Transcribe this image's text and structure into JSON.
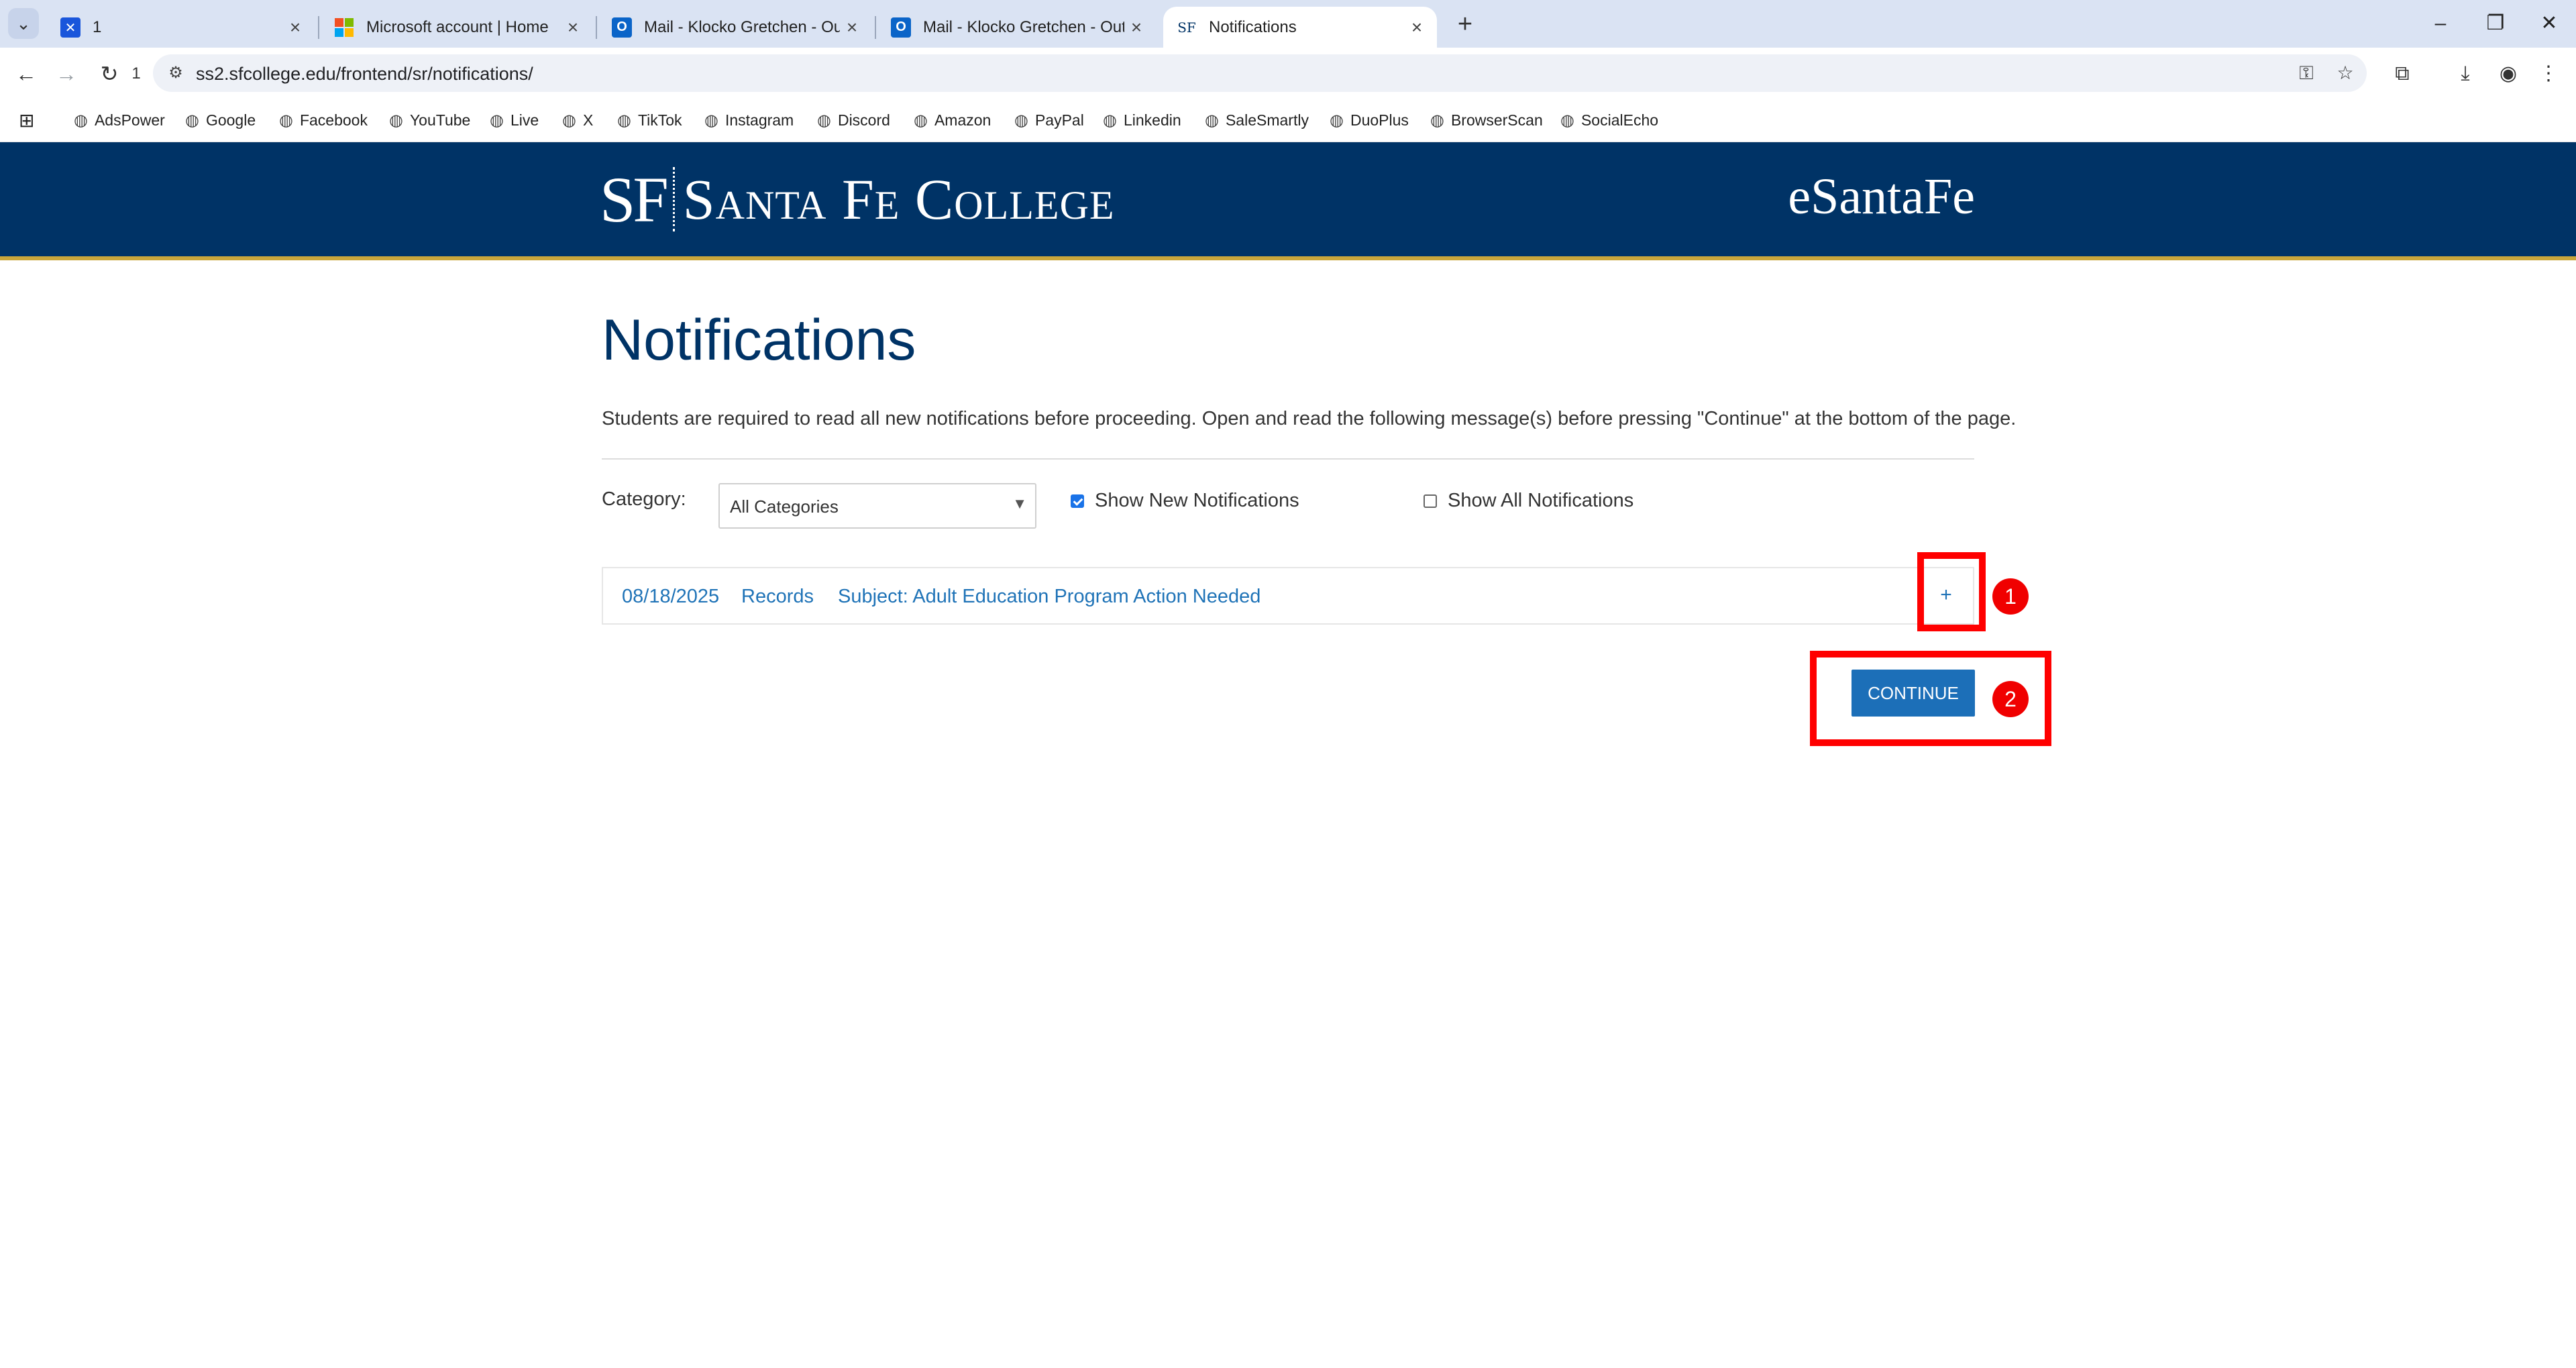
{
  "browser": {
    "tabs": [
      {
        "title": "1",
        "icon": "app-icon"
      },
      {
        "title": "Microsoft account | Home",
        "icon": "microsoft-icon"
      },
      {
        "title": "Mail - Klocko Gretchen - Out",
        "icon": "outlook-icon"
      },
      {
        "title": "Mail - Klocko Gretchen - Out",
        "icon": "outlook-icon"
      },
      {
        "title": "Notifications",
        "icon": "sf-icon",
        "active": true
      }
    ],
    "tab_close": "×",
    "new_tab": "+",
    "window_controls": {
      "minimize": "–",
      "restore": "❐",
      "close": "✕"
    },
    "nav": {
      "back": "←",
      "forward": "→",
      "reload": "↻",
      "extra": "1"
    },
    "url": "ss2.sfcollege.edu/frontend/sr/notifications/",
    "bookmarks": [
      "AdsPower",
      "Google",
      "Facebook",
      "YouTube",
      "Live",
      "X",
      "TikTok",
      "Instagram",
      "Discord",
      "Amazon",
      "PayPal",
      "Linkedin",
      "SaleSmartly",
      "DuoPlus",
      "BrowserScan",
      "SocialEcho"
    ]
  },
  "header": {
    "logo_mono": "SF",
    "logo_name": "Santa Fe College",
    "portal": "eSantaFe"
  },
  "page": {
    "title": "Notifications",
    "instructions": "Students are required to read all new notifications before proceeding. Open and read the following message(s) before pressing \"Continue\" at the bottom of the page.",
    "category_label": "Category:",
    "category_value": "All Categories",
    "show_new": {
      "label": "Show New Notifications",
      "checked": true
    },
    "show_all": {
      "label": "Show All Notifications",
      "checked": false
    },
    "notifications": [
      {
        "date": "08/18/2025",
        "category": "Records",
        "subject": "Subject: Adult Education Program Action Needed",
        "expand": "+"
      }
    ],
    "continue_label": "CONTINUE"
  },
  "annotations": {
    "badge1": "1",
    "badge2": "2",
    "color": "#ff0000"
  }
}
